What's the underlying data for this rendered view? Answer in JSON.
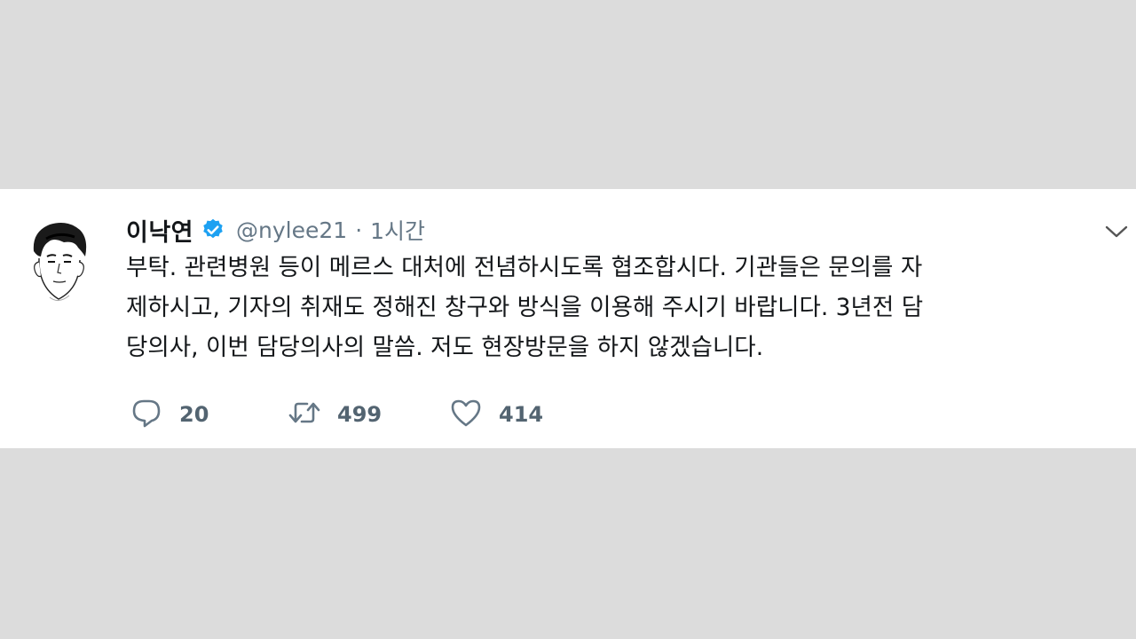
{
  "tweet": {
    "author_name": "이낙연",
    "handle": "@nylee21",
    "separator": "·",
    "time": "1시간",
    "text_lines": [
      "부탁. 관련병원 등이 메르스 대처에 전념하시도록 협조합시다. 기관들은 문의를 자",
      "제하시고, 기자의 취재도 정해진 창구와 방식을 이용해 주시기 바랍니다. 3년전 담",
      "당의사, 이번 담당의사의 말씀. 저도 현장방문을 하지 않겠습니다."
    ],
    "counts": {
      "replies": "20",
      "retweets": "499",
      "likes": "414"
    }
  },
  "icons": {
    "avatar": "avatar-illustration",
    "verified": "verified-badge-icon",
    "menu": "chevron-down-icon",
    "reply": "reply-icon",
    "retweet": "retweet-icon",
    "like": "heart-icon"
  },
  "colors": {
    "background": "#dcdcdc",
    "card": "#ffffff",
    "verified": "#1da1f2",
    "secondary_text": "#657786",
    "primary_text": "#14171a"
  }
}
